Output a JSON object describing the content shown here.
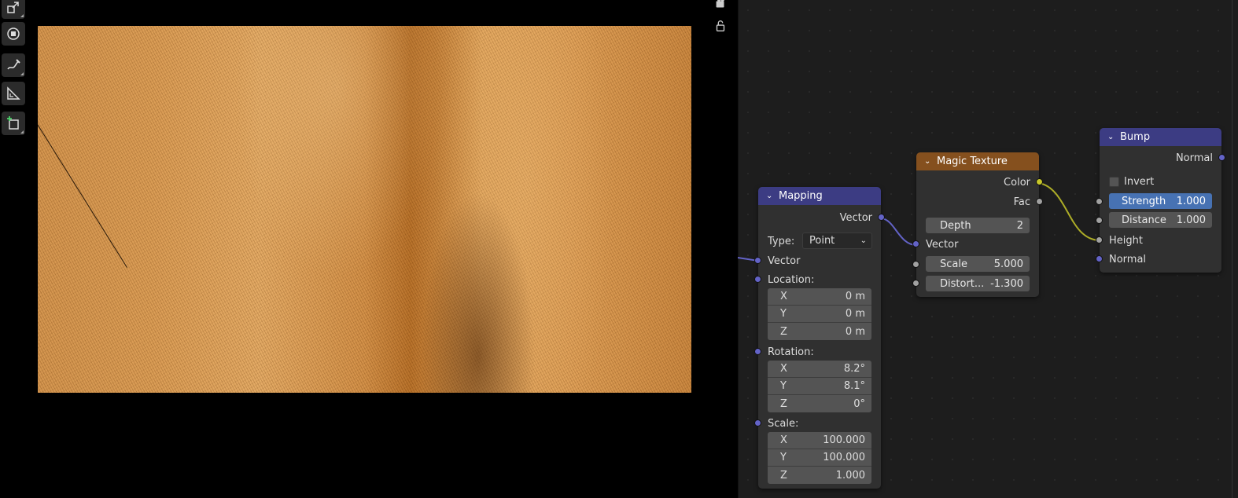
{
  "toolbar": {
    "tools": [
      {
        "icon": "scale-icon"
      },
      {
        "icon": "transform-icon"
      },
      {
        "icon": "annotate-icon"
      },
      {
        "icon": "measure-icon"
      },
      {
        "icon": "add-cube-icon"
      }
    ]
  },
  "viewport": {
    "buttons": [
      {
        "icon": "camera-icon"
      },
      {
        "icon": "lock-icon"
      }
    ],
    "render_colors": {
      "fabric_light": "#e2a862",
      "fabric_dark": "#b56d25"
    }
  },
  "nodes": {
    "mapping": {
      "title": "Mapping",
      "header_color": "#3c3c83",
      "output_vector": "Vector",
      "type_label": "Type:",
      "type_value": "Point",
      "input_vector": "Vector",
      "location_label": "Location:",
      "location": [
        {
          "axis": "X",
          "value": "0 m"
        },
        {
          "axis": "Y",
          "value": "0 m"
        },
        {
          "axis": "Z",
          "value": "0 m"
        }
      ],
      "rotation_label": "Rotation:",
      "rotation": [
        {
          "axis": "X",
          "value": "8.2°"
        },
        {
          "axis": "Y",
          "value": "8.1°"
        },
        {
          "axis": "Z",
          "value": "0°"
        }
      ],
      "scale_label": "Scale:",
      "scale": [
        {
          "axis": "X",
          "value": "100.000"
        },
        {
          "axis": "Y",
          "value": "100.000"
        },
        {
          "axis": "Z",
          "value": "1.000"
        }
      ]
    },
    "magic": {
      "title": "Magic Texture",
      "header_color": "#85501e",
      "out_color": "Color",
      "out_fac": "Fac",
      "depth_label": "Depth",
      "depth_value": "2",
      "in_vector": "Vector",
      "scale_label": "Scale",
      "scale_value": "5.000",
      "distortion_label": "Distort...",
      "distortion_value": "-1.300"
    },
    "bump": {
      "title": "Bump",
      "header_color": "#3c3c83",
      "out_normal": "Normal",
      "invert_label": "Invert",
      "strength_label": "Strength",
      "strength_value": "1.000",
      "distance_label": "Distance",
      "distance_value": "1.000",
      "in_height": "Height",
      "in_normal": "Normal"
    }
  }
}
